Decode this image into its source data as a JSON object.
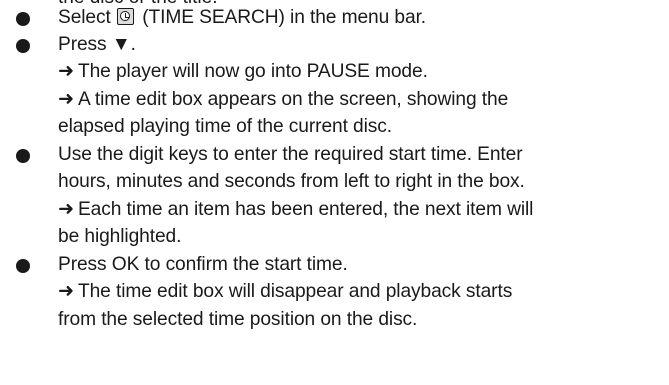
{
  "cut_text": "the disc or the title.",
  "steps": [
    {
      "select_before": "Select ",
      "icon": "clock-icon",
      "select_after": " (TIME SEARCH) in the menu bar."
    },
    {
      "text": "Press ▼.",
      "results": [
        {
          "arrow": "➜",
          "lines": [
            "The player will now go into PAUSE mode."
          ]
        },
        {
          "arrow": "➜",
          "lines": [
            "A time edit box appears on the screen, showing the",
            "elapsed playing time of the current disc."
          ]
        }
      ]
    },
    {
      "lines": [
        "Use the digit keys to enter the required start time. Enter",
        "hours, minutes and seconds from left to right in the box."
      ],
      "results": [
        {
          "arrow": "➜",
          "lines": [
            "Each time an item has been entered, the next item will",
            "be highlighted."
          ]
        }
      ]
    },
    {
      "text": "Press OK to confirm the start time.",
      "results": [
        {
          "arrow": "➜",
          "lines": [
            "The time edit box will disappear and playback starts",
            "from the selected time position on the disc."
          ]
        }
      ]
    }
  ]
}
